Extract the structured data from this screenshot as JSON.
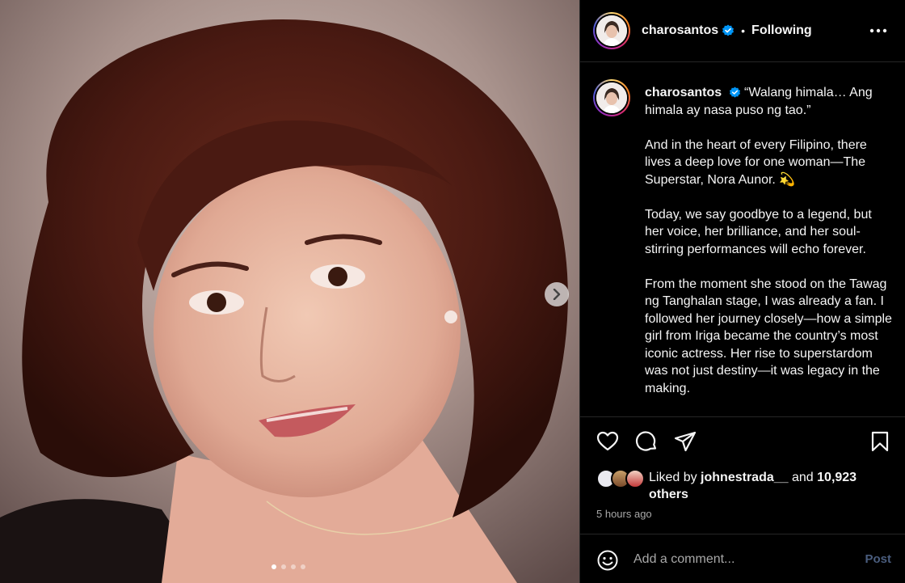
{
  "post": {
    "username": "charosantos",
    "follow_state": "Following",
    "separator": "•",
    "caption": {
      "username": "charosantos",
      "paragraphs": [
        "“Walang himala… Ang himala ay nasa puso ng tao.”",
        "And in the heart of every Filipino, there lives a deep love for one woman—The Superstar, Nora Aunor. 💫",
        "Today, we say goodbye to a legend, but her voice, her brilliance, and her soul-stirring performances will echo forever.",
        "From the moment she stood on the Tawag ng Tanghalan stage, I was already a fan. I followed her journey closely—how a simple girl from Iriga became the country’s most iconic actress. Her rise to superstardom was not just destiny—it was legacy in the making."
      ]
    },
    "likes": {
      "prefix": "Liked by",
      "user": "johnestrada__",
      "middle": "and",
      "count": "10,923",
      "suffix": "others"
    },
    "timestamp": "5 hours ago",
    "comment": {
      "placeholder": "Add a comment...",
      "post_label": "Post"
    },
    "carousel": {
      "total": 4,
      "active_index": 0
    },
    "icons": {
      "verified": "verified-badge-icon",
      "more": "more-options-icon",
      "like": "heart-icon",
      "comment": "comment-icon",
      "share": "paper-plane-icon",
      "save": "bookmark-icon",
      "emoji": "emoji-icon",
      "next": "chevron-right-icon"
    },
    "colors": {
      "verified_blue": "#0095f6",
      "post_button_disabled": "#4a5d7e",
      "muted_text": "#a8a8a8"
    }
  }
}
